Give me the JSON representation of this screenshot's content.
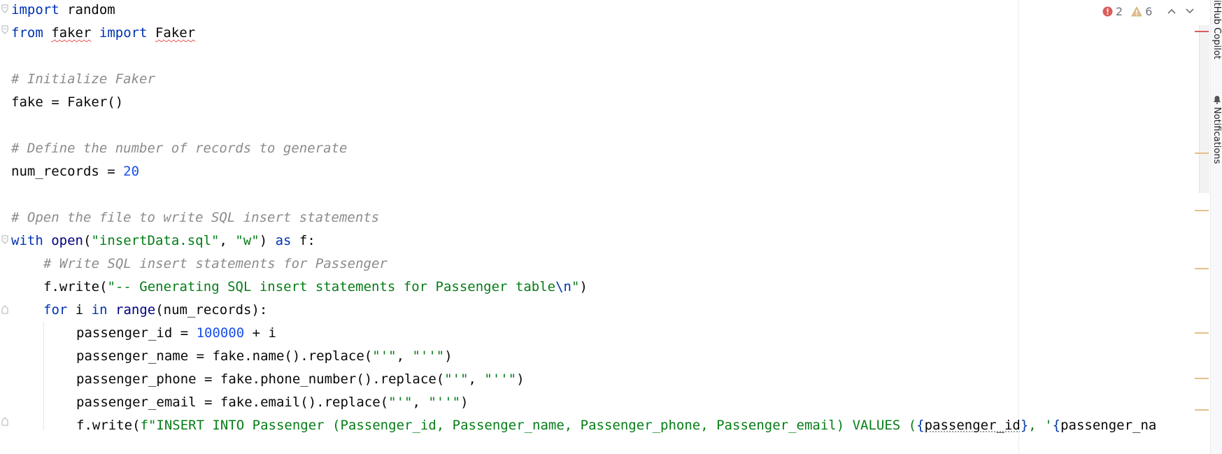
{
  "editor": {
    "language": "python",
    "colors": {
      "background": "#ffffff",
      "keyword": "#0033b3",
      "builtin": "#000080",
      "string": "#067d17",
      "number": "#1750eb",
      "comment": "#8c8c8c",
      "error": "#db5c5c",
      "warning": "#e2c08d"
    },
    "lines": {
      "l1": {
        "kw": "import",
        "rest": " random"
      },
      "l2": {
        "kw1": "from",
        "mod": "faker",
        "kw2": "import",
        "cls": "Faker"
      },
      "l4": {
        "comment": "# Initialize Faker"
      },
      "l5": {
        "code": "fake = Faker()"
      },
      "l7": {
        "comment": "# Define the number of records to generate"
      },
      "l8": {
        "code": "num_records = ",
        "num": "20"
      },
      "l10": {
        "comment": "# Open the file to write SQL insert statements"
      },
      "l11": {
        "kw": "with",
        "fn": "open",
        "p1": "(",
        "s1": "\"insertData.sql\"",
        "p2": ", ",
        "s2": "\"w\"",
        "p3": ") ",
        "kw2": "as",
        "rest": " f:"
      },
      "l12": {
        "comment": "# Write SQL insert statements for Passenger"
      },
      "l13": {
        "code": "f.write(",
        "str": "\"-- Generating SQL insert statements for Passenger table",
        "esc": "\\n",
        "strEnd": "\"",
        "end": ")"
      },
      "l14": {
        "kw": "for",
        "mid": " i ",
        "kw2": "in",
        "fn": "range",
        "rest": "(num_records):"
      },
      "l15": {
        "code": "passenger_id = ",
        "num": "100000",
        "rest": " + i"
      },
      "l16": {
        "code": "passenger_name = fake.name().replace(",
        "s1": "\"'\"",
        "p": ", ",
        "s2": "\"''\"",
        "end": ")"
      },
      "l17": {
        "code": "passenger_phone = fake.phone_number().replace(",
        "s1": "\"'\"",
        "p": ", ",
        "s2": "\"''\"",
        "end": ")"
      },
      "l18": {
        "code": "passenger_email = fake.email().replace(",
        "s1": "\"'\"",
        "p": ", ",
        "s2": "\"''\"",
        "end": ")"
      },
      "l19": {
        "code": "f.write(",
        "str1": "f\"INSERT INTO Passenger (Passenger_id, Passenger_name, Passenger_phone, Passenger_email) VALUES (",
        "b1": "{",
        "var1": "passenger_id",
        "b2": "}",
        "str2": ", '",
        "b3": "{",
        "var2": "passenger_na"
      }
    }
  },
  "inspections": {
    "errors": "2",
    "warnings": "6",
    "error_icon": "error-circle-icon",
    "warning_icon": "warning-triangle-icon",
    "prev_icon": "chevron-up-icon",
    "next_icon": "chevron-down-icon"
  },
  "tool_window_strip": {
    "github_copilot": "GitHub Copilot",
    "notifications": "Notifications",
    "notifications_icon": "bell-icon"
  }
}
